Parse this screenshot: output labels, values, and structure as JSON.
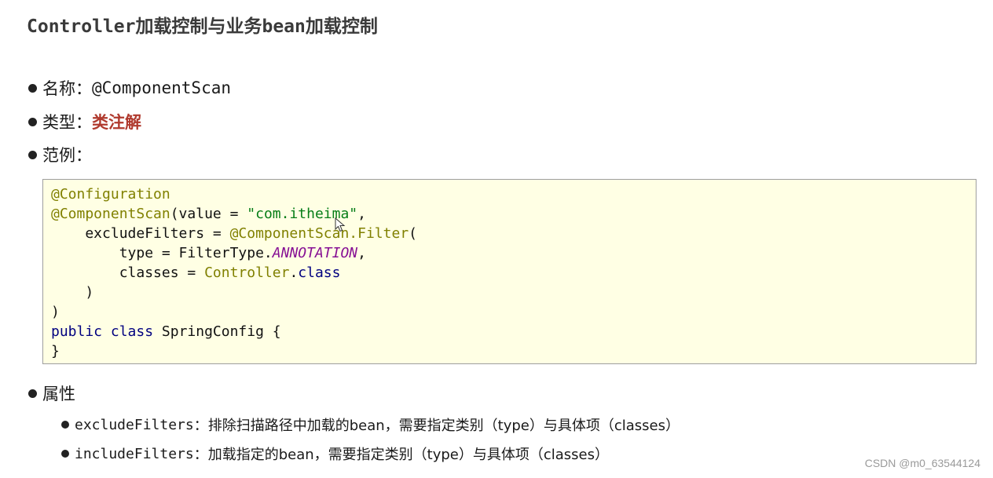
{
  "title": "Controller加载控制与业务bean加载控制",
  "items": [
    {
      "label": "名称：",
      "value": "@ComponentScan"
    },
    {
      "label": "类型：",
      "value": "类注解"
    },
    {
      "label": "范例：",
      "value": ""
    }
  ],
  "code": {
    "l1": "@Configuration",
    "l2_ann": "@ComponentScan",
    "l2_a": "(value = ",
    "l2_str": "\"com.itheima\"",
    "l2_b": ",",
    "l3_a": "    excludeFilters = ",
    "l3_ann": "@ComponentScan.Filter",
    "l3_b": "(",
    "l4_a": "        type = FilterType.",
    "l4_const": "ANNOTATION",
    "l4_b": ",",
    "l5_a": "        classes = ",
    "l5_ann": "Controller",
    "l5_b": ".",
    "l5_kw": "class",
    "l6": "    )",
    "l7": ")",
    "l8_kw1": "public",
    "l8_kw2": "class",
    "l8_rest": " SpringConfig {",
    "l9": "}"
  },
  "attributes": {
    "label": "属性",
    "items": [
      {
        "name": "excludeFilters",
        "desc": "：排除扫描路径中加载的bean，需要指定类别（type）与具体项（classes）"
      },
      {
        "name": "includeFilters",
        "desc": "：加载指定的bean，需要指定类别（type）与具体项（classes）"
      }
    ]
  },
  "watermark": "CSDN @m0_63544124"
}
